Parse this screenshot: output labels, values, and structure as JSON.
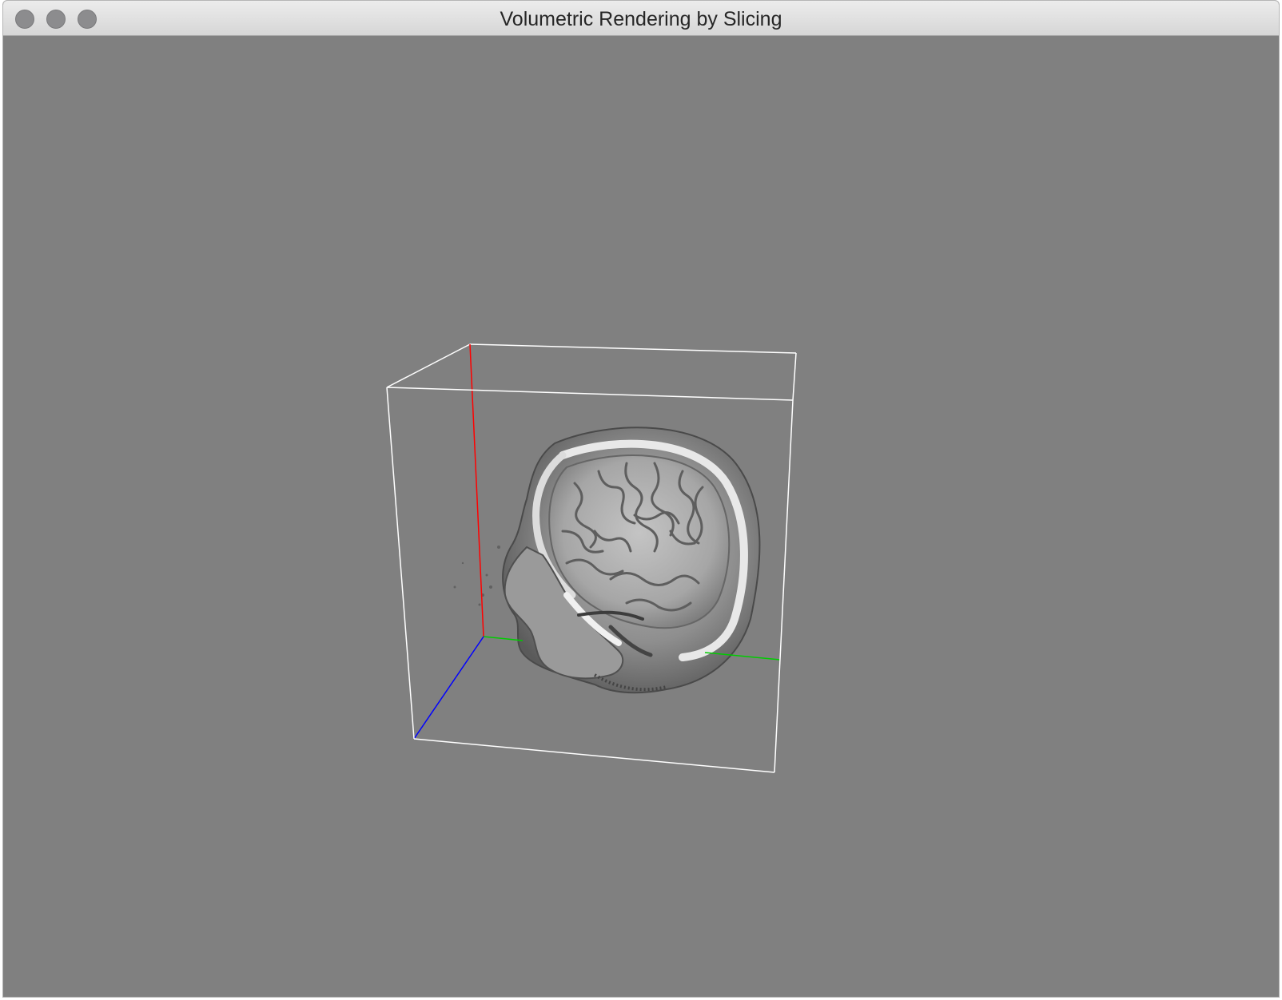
{
  "window": {
    "title": "Volumetric Rendering by Slicing",
    "background_color": "#808080",
    "controls": {
      "close": "close-icon",
      "minimize": "minimize-icon",
      "zoom": "zoom-icon"
    }
  },
  "scene": {
    "bounding_box_color": "#ffffff",
    "axis_colors": {
      "x": "#00cc00",
      "y": "#ff0000",
      "z": "#0000ff"
    },
    "volume": "brain-mri-volume"
  }
}
